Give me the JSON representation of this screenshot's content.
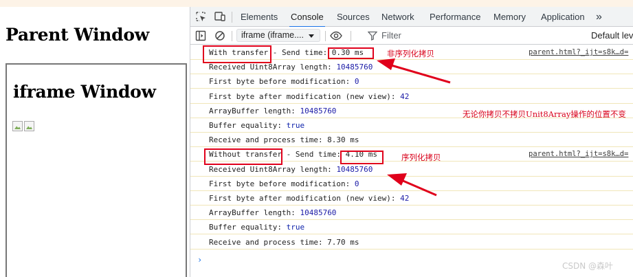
{
  "page": {
    "parent_title": "Parent Window",
    "iframe_title": "iframe Window"
  },
  "devtools": {
    "tabs": [
      {
        "label": "Elements"
      },
      {
        "label": "Console",
        "active": true
      },
      {
        "label": "Sources"
      },
      {
        "label": "Network"
      },
      {
        "label": "Performance"
      },
      {
        "label": "Memory"
      },
      {
        "label": "Application"
      }
    ],
    "more_tabs_glyph": "»",
    "context": "iframe (iframe....",
    "filter_placeholder": "Filter",
    "levels": "Default lev"
  },
  "console": {
    "rows": [
      {
        "text": "With transfer - Send time: 0.30 ms",
        "source": "parent.html?_ijt=s8k…d="
      },
      {
        "label": "Received Uint8Array length: ",
        "value": "10485760",
        "value_type": "number"
      },
      {
        "label": "First byte before modification: ",
        "value": "0",
        "value_type": "number"
      },
      {
        "label": "First byte after modification (new view): ",
        "value": "42",
        "value_type": "number"
      },
      {
        "label": "ArrayBuffer length: ",
        "value": "10485760",
        "value_type": "number"
      },
      {
        "label": "Buffer equality: ",
        "value": "true",
        "value_type": "boolean"
      },
      {
        "text": "Receive and process time: 8.30 ms"
      },
      {
        "text": "Without transfer - Send time: 4.10 ms",
        "source": "parent.html?_ijt=s8k…d="
      },
      {
        "label": "Received Uint8Array length: ",
        "value": "10485760",
        "value_type": "number"
      },
      {
        "label": "First byte before modification: ",
        "value": "0",
        "value_type": "number"
      },
      {
        "label": "First byte after modification (new view): ",
        "value": "42",
        "value_type": "number"
      },
      {
        "label": "ArrayBuffer length: ",
        "value": "10485760",
        "value_type": "number"
      },
      {
        "label": "Buffer equality: ",
        "value": "true",
        "value_type": "boolean"
      },
      {
        "text": "Receive and process time: 7.70 ms"
      }
    ],
    "prompt_glyph": "›"
  },
  "annotations": {
    "note_non_serialized": "非序列化拷贝",
    "note_position": "无论你拷贝不拷贝Unit8Array操作的位置不变",
    "note_serialized": "序列化拷贝",
    "color": "#e0001b"
  },
  "watermark": "CSDN @森叶"
}
